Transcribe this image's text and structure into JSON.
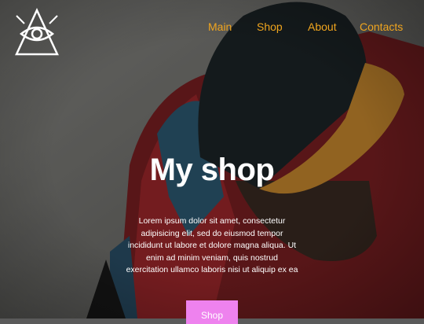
{
  "nav": {
    "items": [
      {
        "label": "Main"
      },
      {
        "label": "Shop"
      },
      {
        "label": "About"
      },
      {
        "label": "Contacts"
      }
    ]
  },
  "logo": {
    "icon": "eye-triangle-icon"
  },
  "hero": {
    "title": "My shop",
    "description": "Lorem ipsum dolor sit amet, consectetur adipisicing elit, sed do eiusmod tempor incididunt ut labore et dolore magna aliqua. Ut enim ad minim veniam, quis nostrud exercitation ullamco laboris nisi ut aliquip ex ea",
    "button_label": "Shop"
  },
  "colors": {
    "nav_link": "#f0a51e",
    "button_bg": "#ee82ee",
    "text": "#ffffff"
  }
}
